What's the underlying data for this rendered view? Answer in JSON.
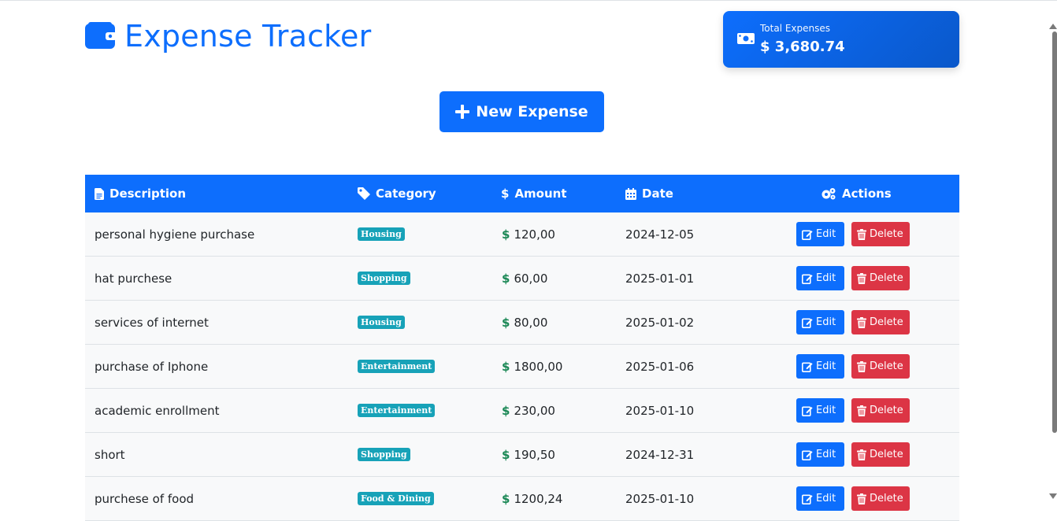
{
  "header": {
    "title": "Expense Tracker",
    "wallet_icon": "wallet-icon"
  },
  "summary": {
    "label": "Total Expenses",
    "value": "$ 3,680.74",
    "icon": "money-bill-icon"
  },
  "toolbar": {
    "new_label": "New Expense"
  },
  "table": {
    "columns": {
      "description": "Description",
      "category": "Category",
      "amount": "Amount",
      "date": "Date",
      "actions": "Actions"
    },
    "rows": [
      {
        "description": "personal hygiene purchase",
        "category": "Housing",
        "amount": "120,00",
        "date": "2024-12-05"
      },
      {
        "description": "hat purchese",
        "category": "Shopping",
        "amount": "60,00",
        "date": "2025-01-01"
      },
      {
        "description": "services of internet",
        "category": "Housing",
        "amount": "80,00",
        "date": "2025-01-02"
      },
      {
        "description": "purchase of Iphone",
        "category": "Entertainment",
        "amount": "1800,00",
        "date": "2025-01-06"
      },
      {
        "description": "academic enrollment",
        "category": "Entertainment",
        "amount": "230,00",
        "date": "2025-01-10"
      },
      {
        "description": "short",
        "category": "Shopping",
        "amount": "190,50",
        "date": "2024-12-31"
      },
      {
        "description": "purchese of food",
        "category": "Food & Dining",
        "amount": "1200,24",
        "date": "2025-01-10"
      }
    ],
    "edit_label": "Edit",
    "delete_label": "Delete",
    "currency_symbol": "$"
  },
  "colors": {
    "primary": "#0d6efd",
    "danger": "#dc3545",
    "badge": "#17a2b8",
    "success": "#198754"
  }
}
